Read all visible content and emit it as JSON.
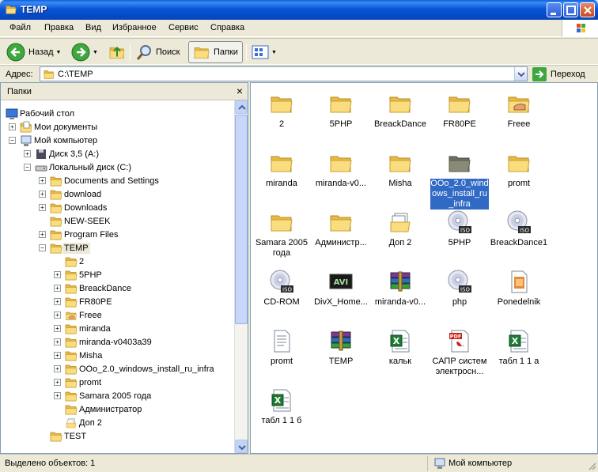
{
  "window": {
    "title": "TEMP"
  },
  "menu": [
    "Файл",
    "Правка",
    "Вид",
    "Избранное",
    "Сервис",
    "Справка"
  ],
  "toolbar": {
    "back": "Назад",
    "search": "Поиск",
    "folders": "Папки"
  },
  "address": {
    "label": "Адрес:",
    "value": "C:\\TEMP",
    "go": "Переход"
  },
  "folders_pane": {
    "header": "Папки",
    "close": "×",
    "tree": [
      "Рабочий стол",
      "Мои документы",
      "Мой компьютер",
      "Диск 3,5 (A:)",
      "Локальный диск (C:)",
      "Documents and Settings",
      "download",
      "Downloads",
      "NEW-SEEK",
      "Program Files",
      "TEMP",
      "2",
      "5PHP",
      "BreackDance",
      "FR80PE",
      "Freee",
      "miranda",
      "miranda-v0403a39",
      "Misha",
      "OOo_2.0_windows_install_ru_infra",
      "promt",
      "Samara  2005 года",
      "Администратор",
      "Доп 2",
      "TEST"
    ]
  },
  "files": [
    {
      "label": "2",
      "icon": "folder-icon"
    },
    {
      "label": "5PHP",
      "icon": "folder-icon"
    },
    {
      "label": "BreackDance",
      "icon": "folder-icon"
    },
    {
      "label": "FR80PE",
      "icon": "folder-icon"
    },
    {
      "label": "Freee",
      "icon": "shared-folder-icon"
    },
    {
      "label": "miranda",
      "icon": "folder-icon"
    },
    {
      "label": "miranda-v0...",
      "icon": "folder-icon"
    },
    {
      "label": "Misha",
      "icon": "folder-icon"
    },
    {
      "label": "OOo_2.0_windows_install_ru_infra",
      "icon": "folder-icon"
    },
    {
      "label": "promt",
      "icon": "folder-icon"
    },
    {
      "label": "Samara  2005 года",
      "icon": "folder-icon"
    },
    {
      "label": "Администр...",
      "icon": "folder-icon"
    },
    {
      "label": "Доп 2",
      "icon": "folder-files-icon"
    },
    {
      "label": "5PHP",
      "icon": "iso-disc-icon"
    },
    {
      "label": "BreackDance1",
      "icon": "iso-disc-icon"
    },
    {
      "label": "CD-ROM",
      "icon": "iso-disc-icon"
    },
    {
      "label": "DivX_Home...",
      "icon": "avi-video-icon"
    },
    {
      "label": "miranda-v0...",
      "icon": "rar-archive-icon"
    },
    {
      "label": "php",
      "icon": "iso-disc-icon"
    },
    {
      "label": "Ponedelnik",
      "icon": "image-file-icon"
    },
    {
      "label": "promt",
      "icon": "text-document-icon"
    },
    {
      "label": "TEMP",
      "icon": "rar-archive-icon"
    },
    {
      "label": "кальк",
      "icon": "excel-document-icon"
    },
    {
      "label": "САПР систем электросн...",
      "icon": "pdf-document-icon"
    },
    {
      "label": "табл 1 1 а",
      "icon": "excel-document-icon"
    },
    {
      "label": "табл 1 1 б",
      "icon": "excel-document-icon"
    }
  ],
  "status": {
    "selected": "Выделено объектов: 1",
    "location": "Мой компьютер"
  },
  "colors": {
    "title_blue": "#0A5FD8",
    "selection": "#316AC5",
    "folder_yellow": "#F5D76E",
    "chrome": "#ECE9D8"
  }
}
